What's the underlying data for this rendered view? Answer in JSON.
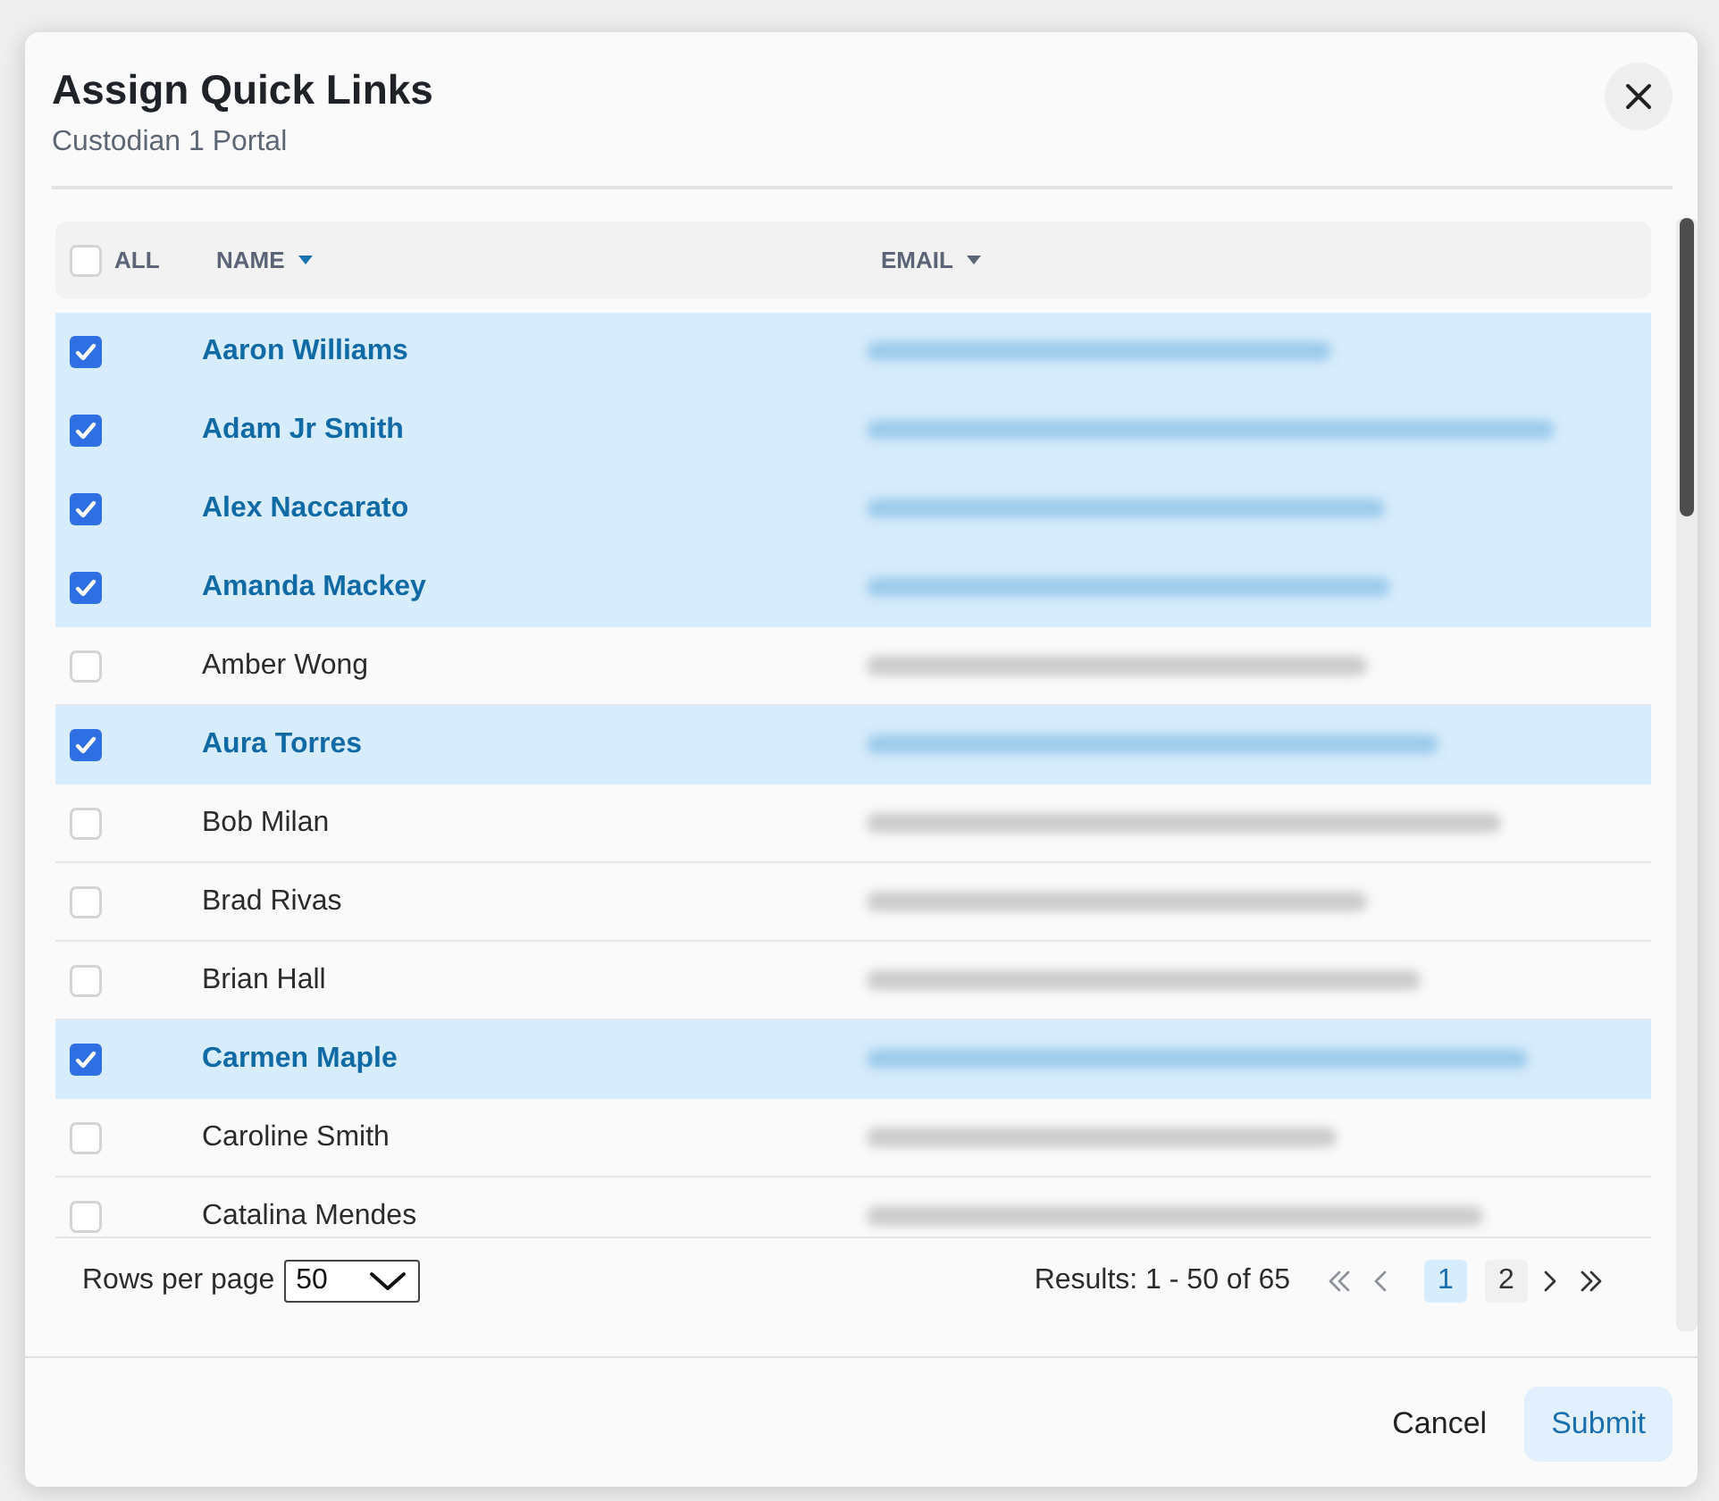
{
  "dialog": {
    "title": "Assign Quick Links",
    "subtitle": "Custodian 1 Portal"
  },
  "table": {
    "select_all": {
      "label": "ALL",
      "checked": false
    },
    "columns": [
      {
        "label": "NAME",
        "sorted": true
      },
      {
        "label": "EMAIL",
        "sorted": false
      }
    ],
    "rows": [
      {
        "name": "Aaron Williams",
        "selected": true
      },
      {
        "name": "Adam Jr Smith",
        "selected": true
      },
      {
        "name": "Alex Naccarato",
        "selected": true
      },
      {
        "name": "Amanda Mackey",
        "selected": true
      },
      {
        "name": "Amber Wong",
        "selected": false
      },
      {
        "name": "Aura Torres",
        "selected": true
      },
      {
        "name": "Bob Milan",
        "selected": false
      },
      {
        "name": "Brad Rivas",
        "selected": false
      },
      {
        "name": "Brian Hall",
        "selected": false
      },
      {
        "name": "Carmen Maple",
        "selected": true
      },
      {
        "name": "Caroline Smith",
        "selected": false
      },
      {
        "name": "Catalina Mendes",
        "selected": false
      }
    ]
  },
  "pagination": {
    "rows_per_page": {
      "label": "Rows per page",
      "value": "50"
    },
    "results": "Results: 1 - 50 of 65",
    "nav": [
      {
        "kind": "first",
        "disabled": true
      },
      {
        "kind": "previous",
        "disabled": true
      },
      {
        "kind": "next",
        "disabled": false
      },
      {
        "kind": "last",
        "disabled": false
      }
    ],
    "pages": [
      {
        "label": "1",
        "selected": true
      },
      {
        "label": "2",
        "selected": false
      }
    ]
  },
  "buttons": [
    {
      "label": "Cancel",
      "kind": "secondary"
    },
    {
      "label": "Submit",
      "kind": "primary"
    }
  ]
}
